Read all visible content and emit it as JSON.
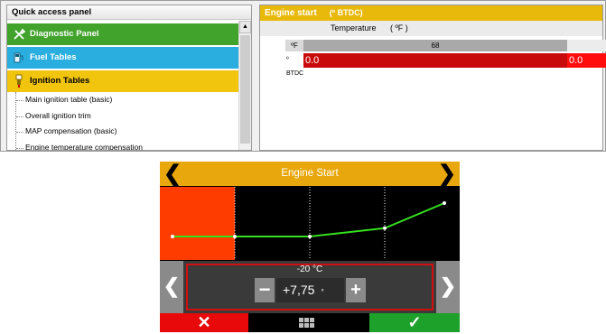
{
  "quick_access": {
    "title": "Quick access panel",
    "categories": [
      {
        "label": "Diagnostic Panel",
        "color": "#41a32c",
        "icon": "wrench-screwdriver-icon"
      },
      {
        "label": "Fuel Tables",
        "color": "#2aaee0",
        "icon": "fuel-pump-icon"
      },
      {
        "label": "Ignition Tables",
        "color": "#f1c40d",
        "icon": "spark-plug-icon"
      }
    ],
    "items": [
      "Main ignition table (basic)",
      "Overall ignition trim",
      "MAP compensation (basic)",
      "Engine temperature compensation"
    ]
  },
  "editor": {
    "title": "Engine start",
    "title_unit": "(º BTDC)",
    "axis_label": "Temperature",
    "axis_unit": "( ºF )",
    "col_unit": "ºF",
    "row_unit": "º BTDC",
    "columns": [
      "68"
    ],
    "values": [
      "0.0",
      "0.0"
    ]
  },
  "device": {
    "title": "Engine Start",
    "prev_glyph": "❮",
    "next_glyph": "❯",
    "temperature": "-20 °C",
    "value": "+7,75",
    "value_unit": "°",
    "minus": "−",
    "plus": "+",
    "cancel": "✕",
    "ok": "✓",
    "accent": "#e8a70c",
    "selected_column_color": "#ff3c00",
    "curve_color": "#35e01f",
    "curve_y_values": [
      0,
      0,
      0,
      0.25,
      1
    ]
  }
}
